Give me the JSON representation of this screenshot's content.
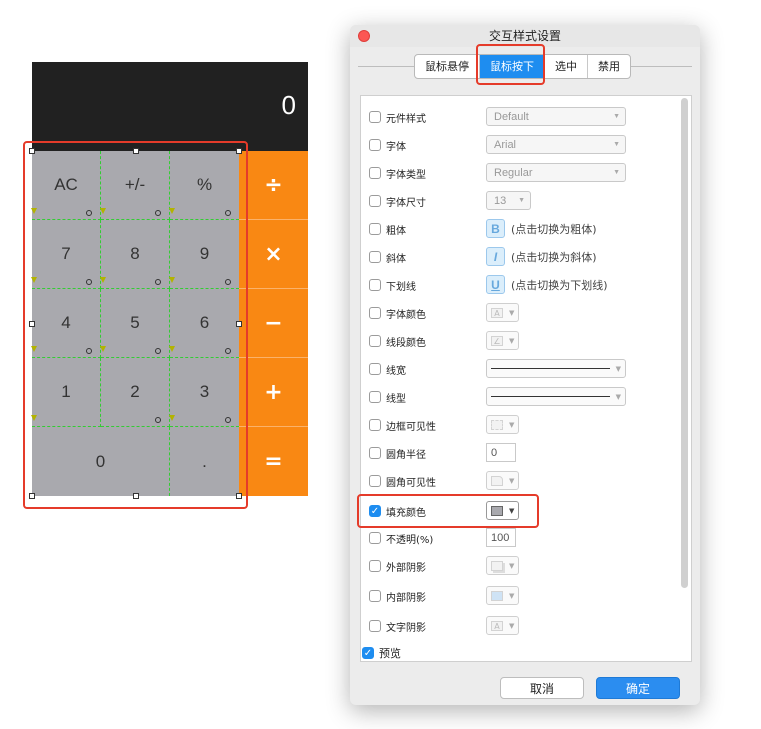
{
  "calculator": {
    "display": "0",
    "keys": [
      {
        "label": "AC"
      },
      {
        "label": "+/-"
      },
      {
        "label": "%"
      },
      {
        "label": "7"
      },
      {
        "label": "8"
      },
      {
        "label": "9"
      },
      {
        "label": "4"
      },
      {
        "label": "5"
      },
      {
        "label": "6"
      },
      {
        "label": "1"
      },
      {
        "label": "2"
      },
      {
        "label": "3"
      },
      {
        "label": "0"
      },
      {
        "label": "."
      }
    ],
    "operators": [
      "÷",
      "×",
      "−",
      "+",
      "="
    ],
    "colors": {
      "display_bg": "#212121",
      "key_bg": "#a9a9ae",
      "operator_bg": "#f98813",
      "selection": "#e53b2a"
    }
  },
  "dialog": {
    "title": "交互样式设置",
    "tabs": [
      {
        "label": "鼠标悬停",
        "active": false
      },
      {
        "label": "鼠标按下",
        "active": true
      },
      {
        "label": "选中",
        "active": false
      },
      {
        "label": "禁用",
        "active": false
      }
    ],
    "rows": {
      "component_style": {
        "label": "元件样式",
        "value": "Default"
      },
      "font": {
        "label": "字体",
        "value": "Arial"
      },
      "font_type": {
        "label": "字体类型",
        "value": "Regular"
      },
      "font_size": {
        "label": "字体尺寸",
        "value": "13"
      },
      "bold": {
        "label": "粗体",
        "icon": "B",
        "text": "(点击切换为粗体)"
      },
      "italic": {
        "label": "斜体",
        "icon": "I",
        "text": "(点击切换为斜体)"
      },
      "underline": {
        "label": "下划线",
        "icon": "U",
        "text": "(点击切换为下划线)"
      },
      "font_color": {
        "label": "字体颜色"
      },
      "line_color": {
        "label": "线段颜色"
      },
      "line_width": {
        "label": "线宽"
      },
      "line_type": {
        "label": "线型"
      },
      "border_visibility": {
        "label": "边框可见性"
      },
      "corner_radius": {
        "label": "圆角半径",
        "value": "0"
      },
      "corner_visibility": {
        "label": "圆角可见性"
      },
      "fill_color": {
        "label": "填充颜色",
        "checked": true
      },
      "opacity": {
        "label": "不透明(%)",
        "value": "100"
      },
      "outer_shadow": {
        "label": "外部阴影"
      },
      "inner_shadow": {
        "label": "内部阴影"
      },
      "text_shadow": {
        "label": "文字阴影"
      }
    },
    "preview": {
      "label": "预览",
      "checked": true
    },
    "buttons": {
      "cancel": "取消",
      "ok": "确定"
    },
    "colors": {
      "accent": "#1e8df0",
      "highlight": "#e53b2a"
    }
  }
}
